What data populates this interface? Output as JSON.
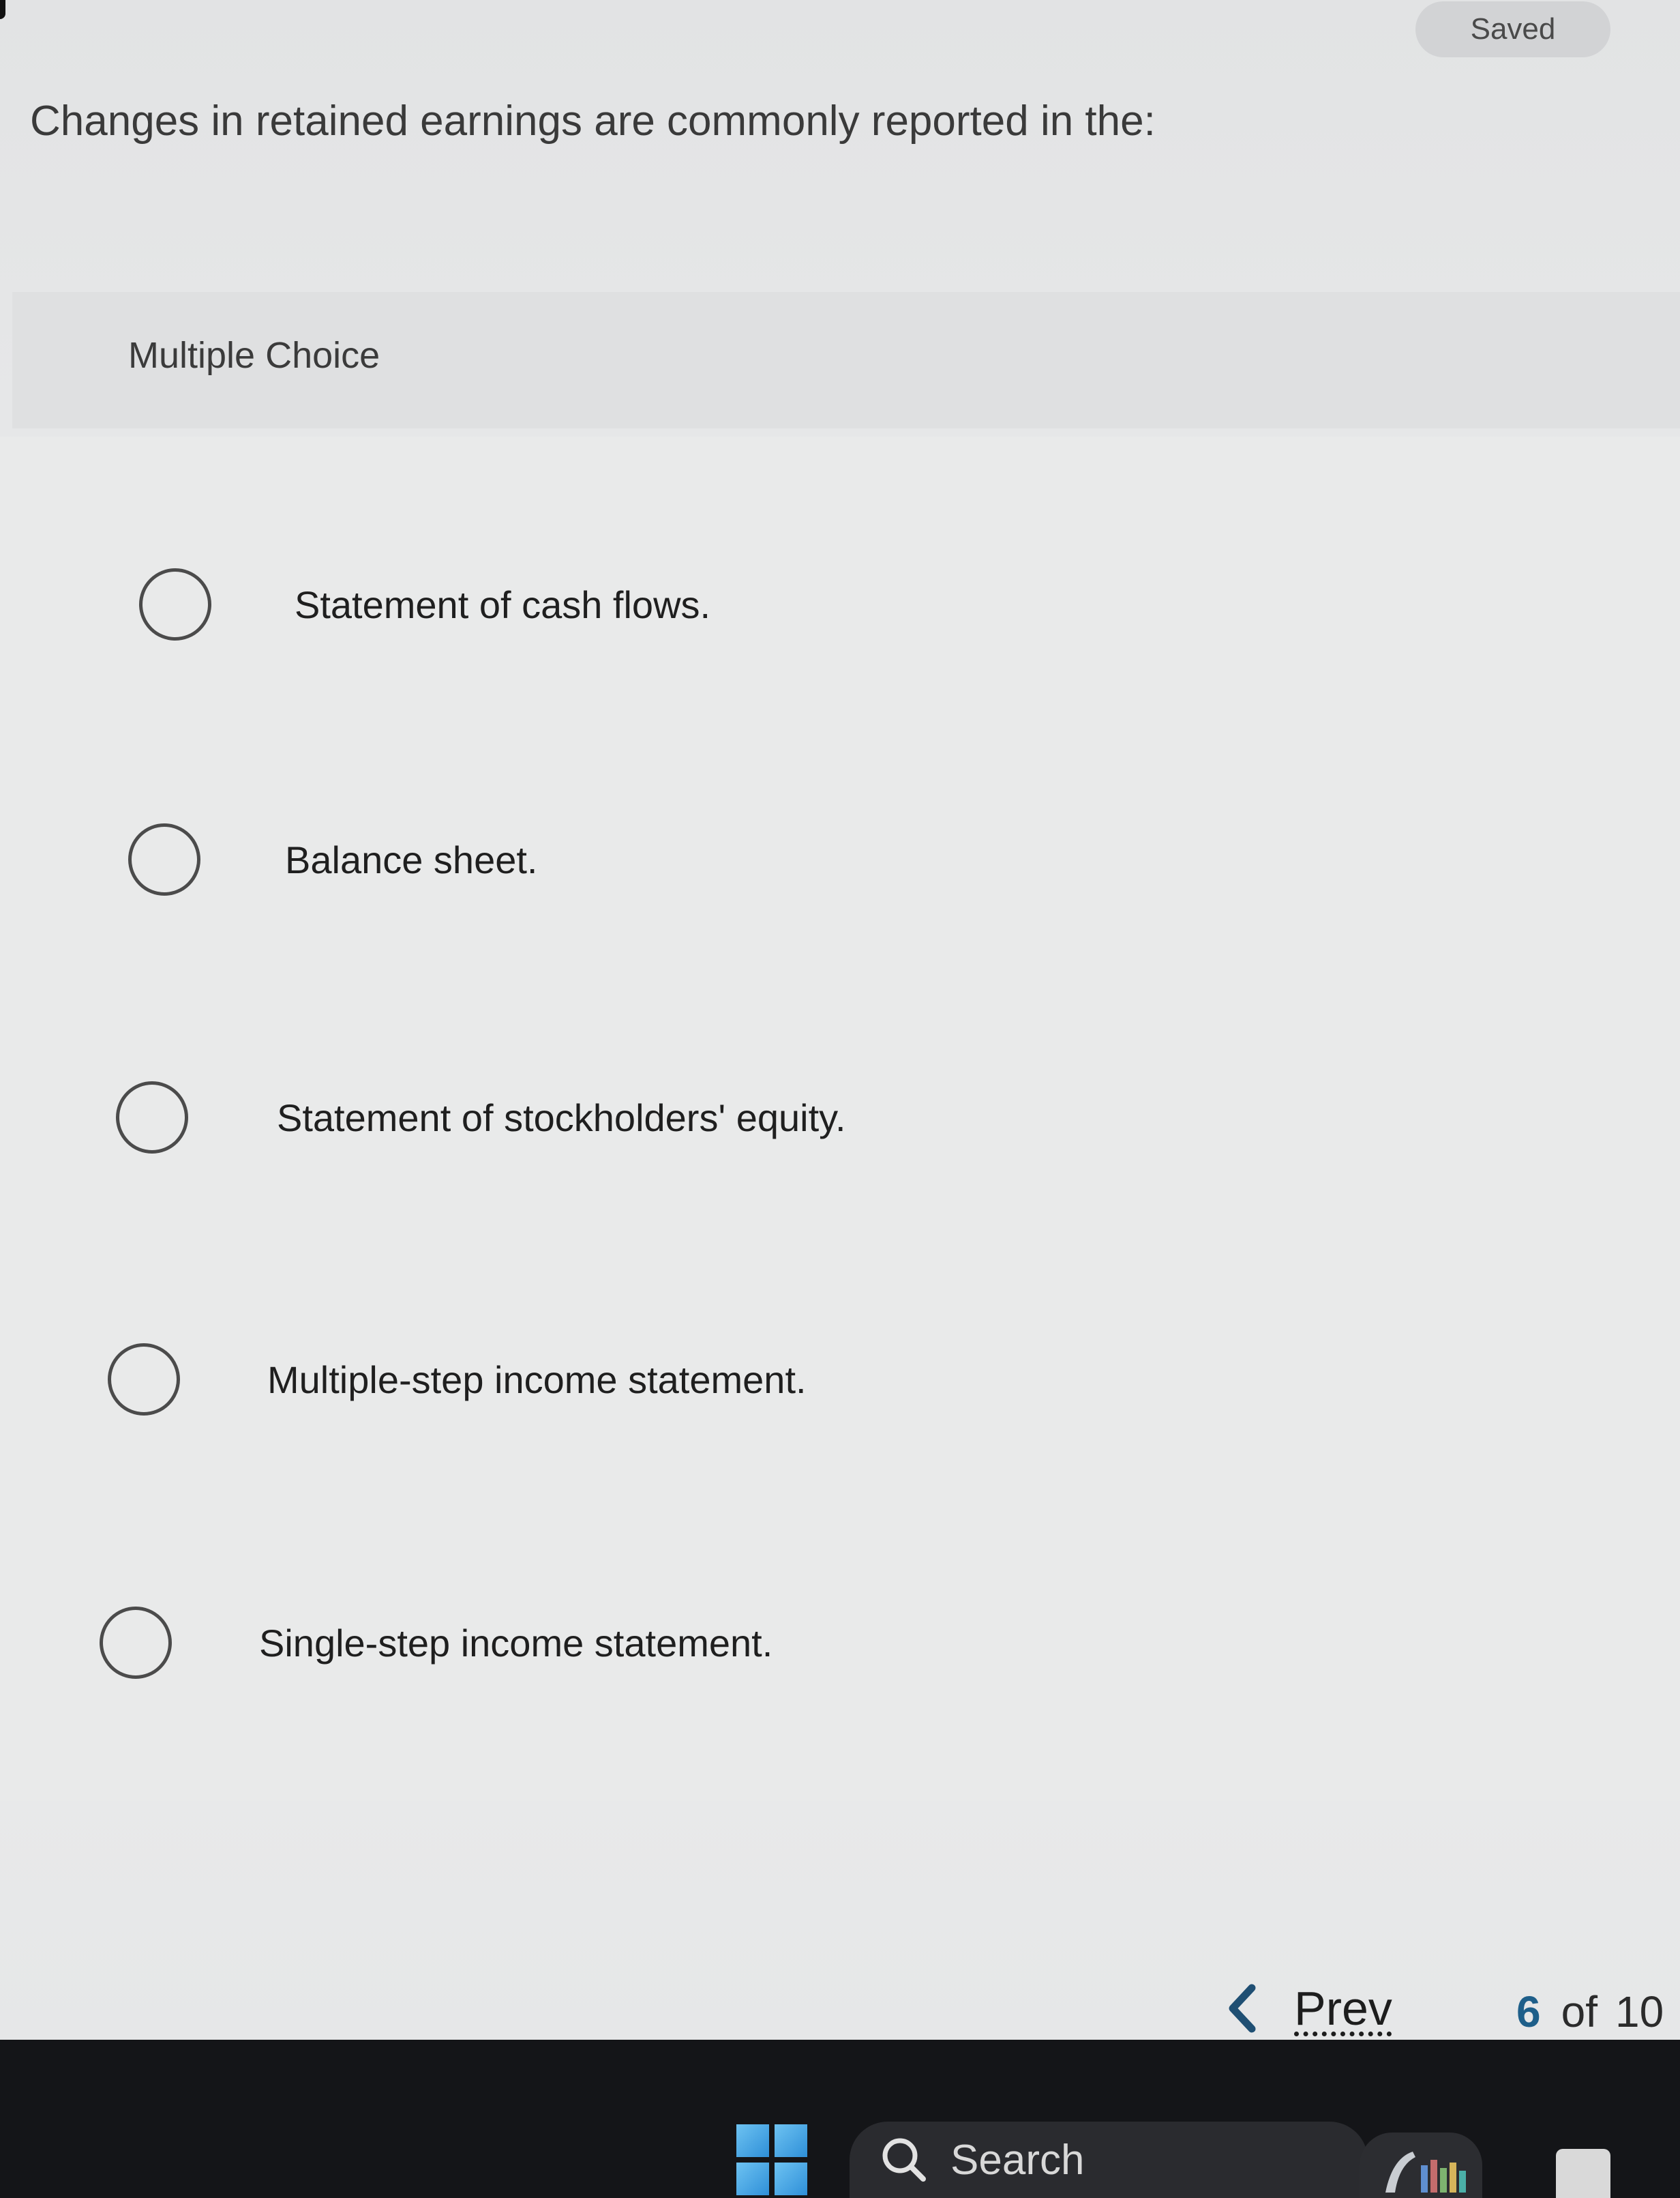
{
  "header": {
    "saved_label": "Saved"
  },
  "question": {
    "text": "Changes in retained earnings are commonly reported in the:"
  },
  "question_type": {
    "label": "Multiple Choice"
  },
  "choices": [
    {
      "label": "Statement of cash flows.",
      "selected": false
    },
    {
      "label": "Balance sheet.",
      "selected": false
    },
    {
      "label": "Statement of stockholders' equity.",
      "selected": false
    },
    {
      "label": "Multiple-step income statement.",
      "selected": false
    },
    {
      "label": "Single-step income statement.",
      "selected": false
    }
  ],
  "navigation": {
    "prev_label": "Prev",
    "current_page": "6",
    "of_label": "of",
    "total_pages": "10"
  },
  "taskbar": {
    "search_label": "Search",
    "start_icon": "windows-logo-icon",
    "search_icon": "search-icon"
  }
}
